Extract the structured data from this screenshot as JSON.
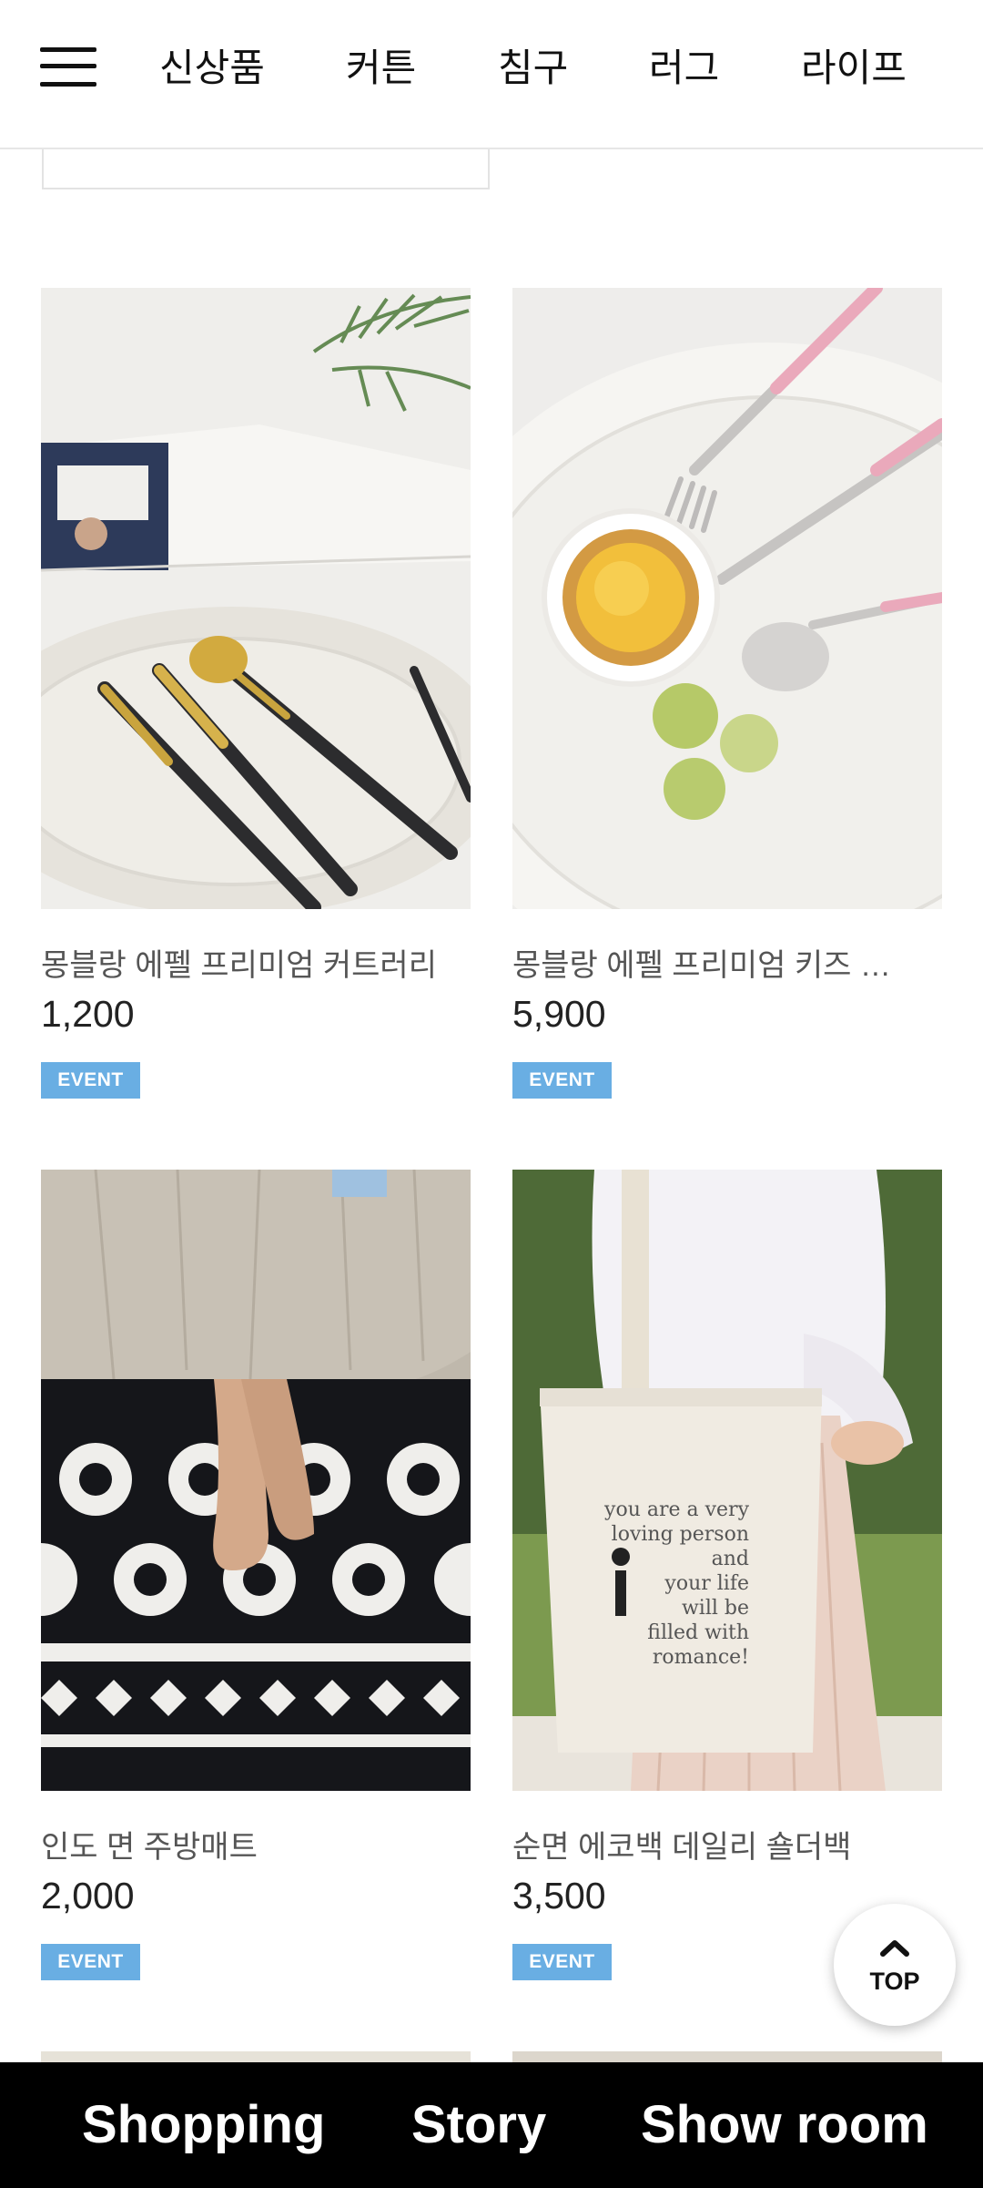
{
  "nav": {
    "items": [
      "신상품",
      "커튼",
      "침구",
      "러그",
      "라이프"
    ]
  },
  "products": [
    {
      "name": "몽블랑 에펠 프리미엄 커트러리",
      "price": "1,200",
      "badge": "EVENT"
    },
    {
      "name": "몽블랑 에펠 프리미엄 키즈 …",
      "price": "5,900",
      "badge": "EVENT"
    },
    {
      "name": "인도 면 주방매트",
      "price": "2,000",
      "badge": "EVENT"
    },
    {
      "name": "순면 에코백 데일리 숄더백",
      "price": "3,500",
      "badge": "EVENT"
    }
  ],
  "bag_print": [
    "you are a very",
    "loving person",
    "and",
    "your life",
    "will be",
    "filled with",
    "romance!"
  ],
  "top_button": {
    "label": "TOP"
  },
  "bottom_bar": {
    "items": [
      "Shopping",
      "Story",
      "Show room"
    ]
  },
  "colors": {
    "badge": "#69aee3",
    "bottom_bar": "#000000"
  },
  "icons": {
    "menu": "hamburger-icon",
    "top": "chevron-up-icon"
  }
}
